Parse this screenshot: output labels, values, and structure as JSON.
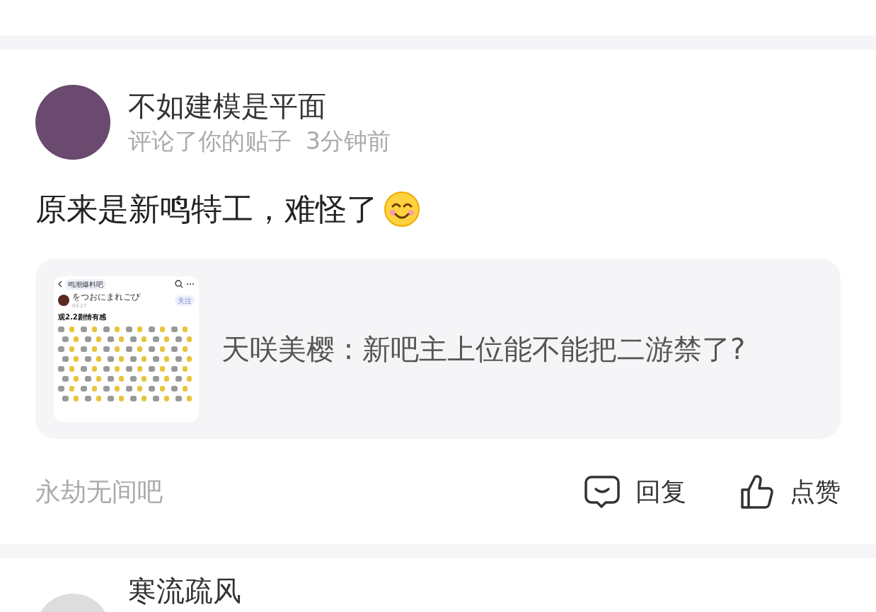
{
  "notification": {
    "user": {
      "name": "不如建模是平面",
      "action": "评论了你的贴子",
      "time": "3分钟前"
    },
    "comment": "原来是新鸣特工，难怪了",
    "quote": {
      "text": "天咲美樱 : 新吧主上位能不能把二游禁了?",
      "thumbnail": {
        "forum": "鸣潮爆料吧",
        "author": "をつおにまれごび",
        "date": "03-27",
        "follow": "关注",
        "title": "观2.2剧情有感"
      }
    },
    "forum": "永劫无间吧",
    "actions": [
      {
        "kind": "reply",
        "label": "回复"
      },
      {
        "kind": "like",
        "label": "点赞"
      }
    ]
  },
  "next_notification": {
    "user": {
      "name": "寒流疏风"
    }
  }
}
